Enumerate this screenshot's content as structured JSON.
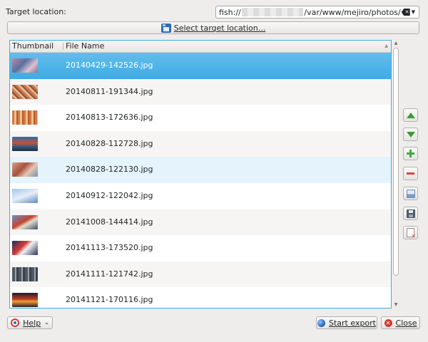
{
  "header": {
    "target_label": "Target location:",
    "location_prefix": "fish://",
    "location_suffix": "/var/www/mejiro/photos/",
    "clear_icon": "clear-text-icon",
    "dropdown_icon": "chevron-down-icon"
  },
  "select_button": {
    "label": "Select target location...",
    "icon": "folder-network-icon"
  },
  "table": {
    "columns": [
      "Thumbnail",
      "File Name"
    ],
    "rows": [
      {
        "file": "20140429-142526.jpg",
        "state": "selected",
        "thumb": "linear-gradient(135deg,#b98aa6,#5a6fa0 40%,#d9c2d0 70%,#8a6d90)"
      },
      {
        "file": "20140811-191344.jpg",
        "state": "alt",
        "thumb": "repeating-linear-gradient(45deg,#c9774f 0 3px,#e3b58f 3px 6px,#8f4f3c 6px 8px)"
      },
      {
        "file": "20140813-172636.jpg",
        "state": "normal",
        "thumb": "repeating-linear-gradient(90deg,#d27a45 0 3px,#edc08a 3px 6px,#b85c33 6px 8px)"
      },
      {
        "file": "20140828-112728.jpg",
        "state": "alt",
        "thumb": "linear-gradient(180deg,#2d6d9e,#c94f3c 45%,#2f5c7a 70%,#1b2f3f)"
      },
      {
        "file": "20140828-122130.jpg",
        "state": "hover",
        "thumb": "linear-gradient(135deg,#d9a08a,#a8523c 40%,#e3c7b4 65%,#7c8fa8)"
      },
      {
        "file": "20140912-122042.jpg",
        "state": "normal",
        "thumb": "linear-gradient(160deg,#9fc6ee,#e7eef6 50%,#5b8ac0)"
      },
      {
        "file": "20141008-144414.jpg",
        "state": "alt",
        "thumb": "linear-gradient(150deg,#6b8fbf,#c4452f 45%,#e4dcd0 60%,#3b4f66)"
      },
      {
        "file": "20141113-173520.jpg",
        "state": "normal",
        "thumb": "linear-gradient(135deg,#1e2f55,#d63a3a 40%,#f2f2f2 55%,#28345c)"
      },
      {
        "file": "20141111-121742.jpg",
        "state": "alt",
        "thumb": "repeating-linear-gradient(90deg,#4f5963 0 4px,#9aa5ae 4px 6px,#39424b 6px 9px)"
      },
      {
        "file": "20141121-170116.jpg",
        "state": "normal",
        "thumb": "linear-gradient(180deg,#1a1f2e,#c43d24 45%,#f0a030 60%,#2a2030)"
      }
    ]
  },
  "scrollbar": {
    "up_icon": "scroll-up-icon",
    "down_icon": "scroll-down-icon"
  },
  "side_buttons": [
    "move-up-icon",
    "move-down-icon",
    "add-icon",
    "remove-icon",
    "add-images-icon",
    "save-list-icon",
    "clear-list-icon"
  ],
  "footer": {
    "help_label": "Help",
    "export_label": "Start export",
    "close_label": "Close"
  }
}
